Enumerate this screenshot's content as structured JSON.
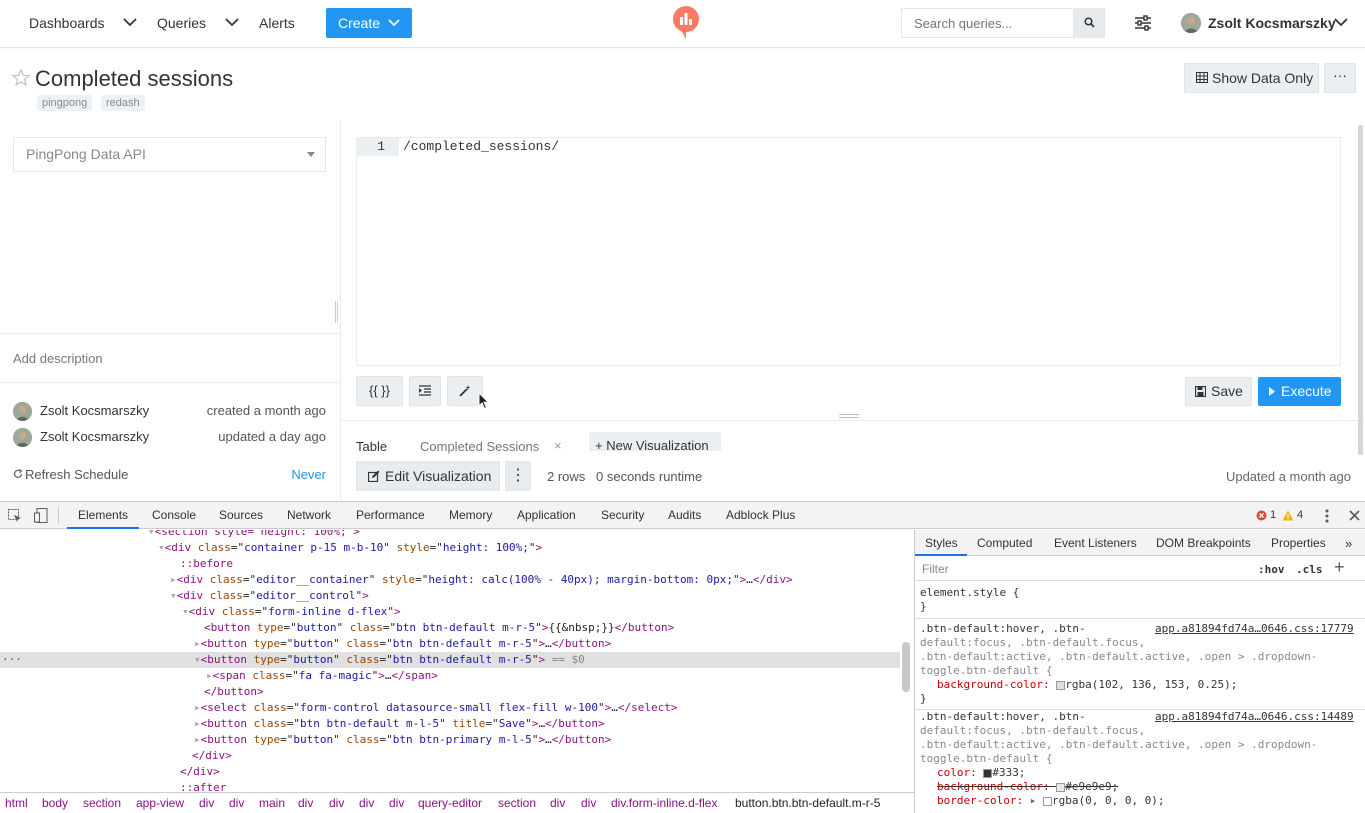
{
  "nav": {
    "dashboards": "Dashboards",
    "queries": "Queries",
    "alerts": "Alerts",
    "create": "Create",
    "search_placeholder": "Search queries...",
    "user_name": "Zsolt Kocsmarszky"
  },
  "query": {
    "title": "Completed sessions",
    "tags": [
      "pingpong",
      "redash"
    ],
    "show_data_only": "Show Data Only",
    "more": "···"
  },
  "left": {
    "datasource": "PingPong Data API",
    "add_description": "Add description",
    "creator": "Zsolt Kocsmarszky",
    "created": "created a month ago",
    "updater": "Zsolt Kocsmarszky",
    "updated": "updated a day ago",
    "refresh_schedule": "Refresh Schedule",
    "refresh_value": "Never"
  },
  "editor": {
    "line_number": "1",
    "code": "/completed_sessions/",
    "params_btn": "{{ }}",
    "save": "Save",
    "execute": "Execute"
  },
  "results": {
    "tab_table": "Table",
    "tab_completed": "Completed Sessions",
    "tab_close": "×",
    "new_viz": "+ New Visualization",
    "edit_viz": "Edit Visualization",
    "kebab": "⋮",
    "rows": "2 rows",
    "runtime": "0 seconds runtime",
    "updated": "Updated a month ago"
  },
  "devtools": {
    "tabs": [
      "Elements",
      "Console",
      "Sources",
      "Network",
      "Performance",
      "Memory",
      "Application",
      "Security",
      "Audits",
      "Adblock Plus"
    ],
    "errors": "1",
    "warnings": "4",
    "styles_tabs": [
      "Styles",
      "Computed",
      "Event Listeners",
      "DOM Breakpoints",
      "Properties"
    ],
    "filter_placeholder": "Filter",
    "hov": ":hov",
    "cls": ".cls",
    "breadcrumbs": [
      "html",
      "body",
      "section",
      "app-view",
      "div",
      "div",
      "main",
      "div",
      "div",
      "div",
      "div",
      "query-editor",
      "section",
      "div",
      "div",
      "div.form-inline.d-flex",
      "button.btn.btn-default.m-r-5"
    ],
    "dom": {
      "l0_open": "<section style=\"height: 100%;\">",
      "l1_tag": "div",
      "l1_class": "container p-15 m-b-10",
      "l1_style": "height: 100%;",
      "l2": "::before",
      "l3_class": "editor__container",
      "l3_style": "height: calc(100% - 40px); margin-bottom: 0px;",
      "l4_class": "editor__control",
      "l5_class": "form-inline d-flex",
      "l6_class": "btn btn-default m-r-5",
      "l6_text": "{{&nbsp;}}",
      "l7_class": "btn btn-default m-r-5",
      "l8_class": "btn btn-default m-r-5",
      "l8_sel": "== $0",
      "l9_class": "fa fa-magic",
      "l10": "</button>",
      "l11_class": "form-control datasource-small flex-fill w-100",
      "l12_class": "btn btn-default m-l-5",
      "l12_title": "Save",
      "l13_class": "btn btn-primary m-l-5",
      "l14": "</div>",
      "l15": "</div>",
      "l16": "::after"
    },
    "styles": {
      "element_style": "element.style {",
      "close_brace": "}",
      "r1_sel1": ".btn-default:hover, .btn-",
      "r1_sel2": "default:focus, .btn-default.focus,",
      "r1_sel3": ".btn-default:active, .btn-default.active, .open > .dropdown-",
      "r1_sel4": "toggle.btn-default {",
      "r1_src": "app.a81894fd74a…0646.css:17779",
      "r1_prop": "background-color:",
      "r1_val": "rgba(102, 136, 153, 0.25);",
      "r2_sel1": ".btn-default:hover, .btn-",
      "r2_sel2": "default:focus, .btn-default.focus,",
      "r2_sel3": ".btn-default:active, .btn-default.active, .open > .dropdown-",
      "r2_sel4": "toggle.btn-default {",
      "r2_src": "app.a81894fd74a…0646.css:14489",
      "r2_p1": "color:",
      "r2_v1": "#333;",
      "r2_p2": "background-color:",
      "r2_v2": "#e9e9e9;",
      "r2_p3": "border-color:",
      "r2_v3": "rgba(0, 0, 0, 0);"
    }
  },
  "colors": {
    "primary": "#2196f3",
    "logo": "#ff7964",
    "link": "#2196f3"
  }
}
